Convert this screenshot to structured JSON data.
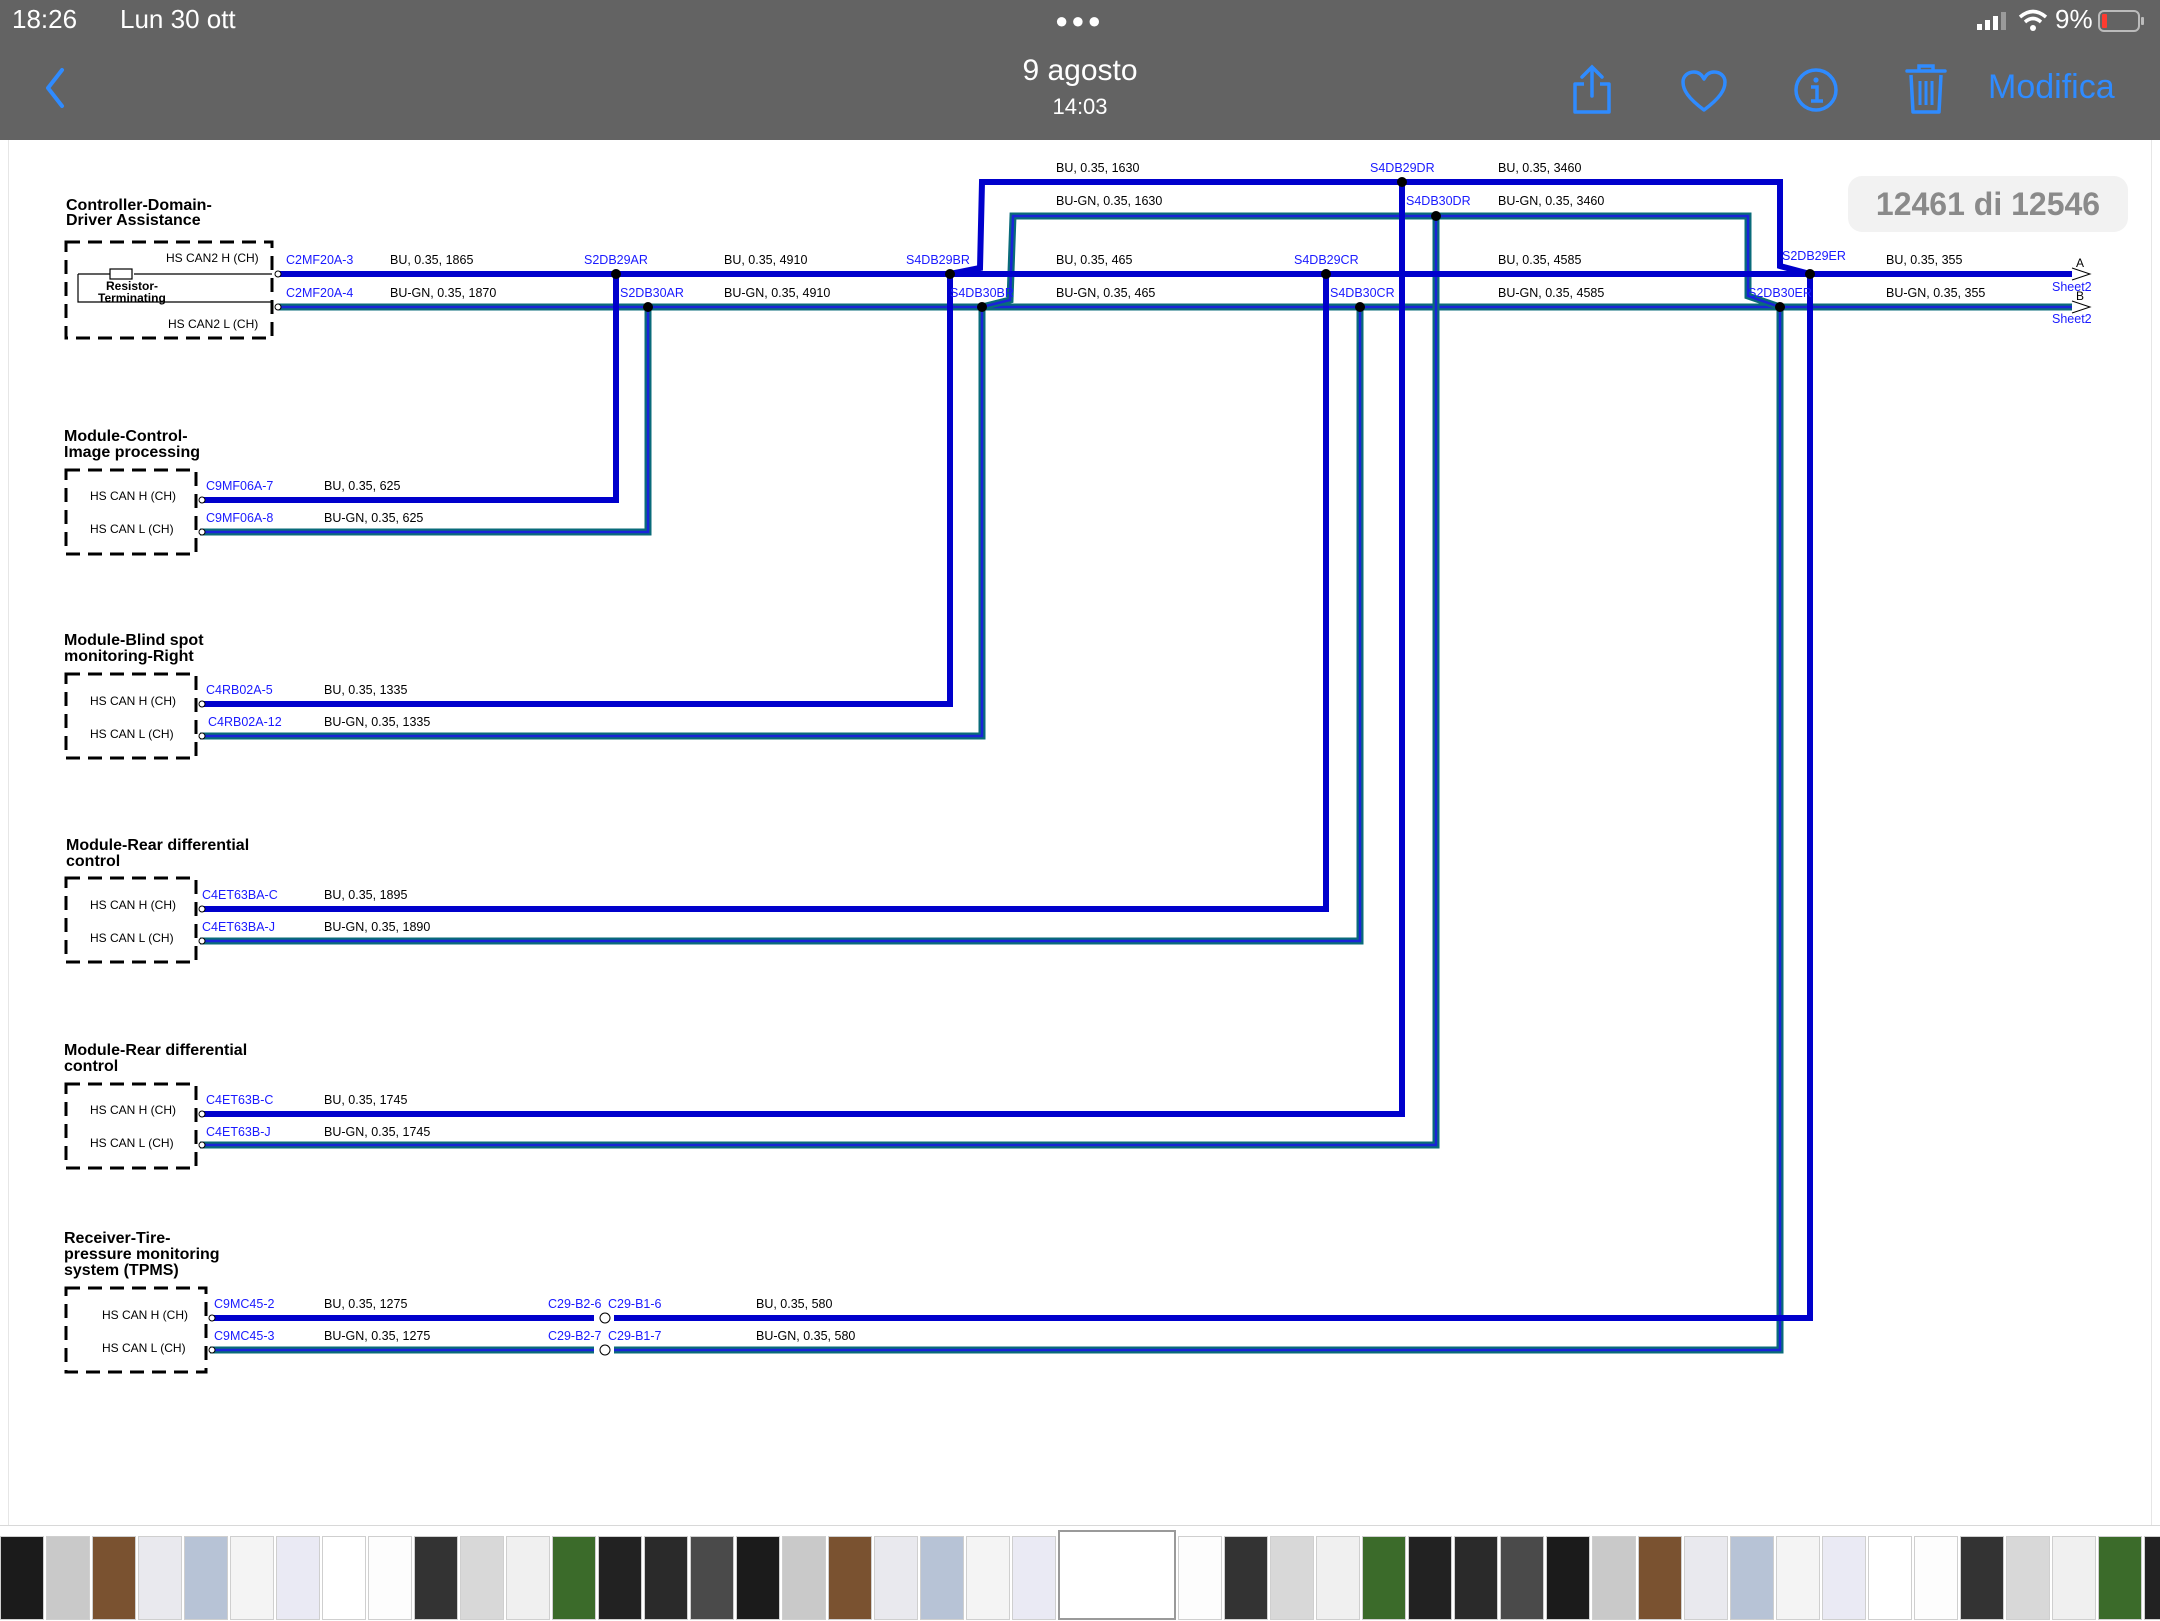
{
  "status": {
    "time": "18:26",
    "date": "Lun 30 ott",
    "battery": "9%"
  },
  "nav": {
    "title": "9 agosto",
    "subtitle": "14:03",
    "edit_label": "Modifica",
    "icons": [
      "back-chevron-icon",
      "share-icon",
      "heart-icon",
      "info-icon",
      "trash-icon"
    ]
  },
  "counter": "12461 di 12546",
  "colors": {
    "bu_wire": "#0000cc",
    "bu_gn_outer": "#0a6b7a",
    "bu_gn_inner": "#1a23d8",
    "label_blue": "#1a1aff",
    "accent": "#2f8bff"
  },
  "diagram": {
    "modules": [
      {
        "title1": "Controller-Domain-",
        "title2": "Driver Assistance",
        "h": "HS CAN2 H (CH)",
        "l": "HS CAN2 L (CH)",
        "resistor": "Resistor-",
        "resistor2": "Terminating"
      },
      {
        "title1": "Module-Control-",
        "title2": "Image processing",
        "h": "HS CAN H (CH)",
        "l": "HS CAN L (CH)"
      },
      {
        "title1": "Module-Blind spot",
        "title2": "monitoring-Right",
        "h": "HS CAN H (CH)",
        "l": "HS CAN L (CH)"
      },
      {
        "title1": "Module-Rear differential",
        "title2": "control",
        "h": "HS CAN H (CH)",
        "l": "HS CAN L (CH)"
      },
      {
        "title1": "Module-Rear differential",
        "title2": "control",
        "h": "HS CAN H (CH)",
        "l": "HS CAN L (CH)"
      },
      {
        "title1": "Receiver-Tire-",
        "title2": "pressure monitoring",
        "title3": "system (TPMS)",
        "h": "HS CAN H (CH)",
        "l": "HS CAN L (CH)"
      }
    ],
    "connectors": {
      "c2mf20a_3": "C2MF20A-3",
      "c2mf20a_4": "C2MF20A-4",
      "c9mf06a_7": "C9MF06A-7",
      "c9mf06a_8": "C9MF06A-8",
      "c4rb02a_5": "C4RB02A-5",
      "c4rb02a_12": "C4RB02A-12",
      "c4et63ba_c": "C4ET63BA-C",
      "c4et63ba_j": "C4ET63BA-J",
      "c4et63b_c": "C4ET63B-C",
      "c4et63b_j": "C4ET63B-J",
      "c9mc45_2": "C9MC45-2",
      "c9mc45_3": "C9MC45-3",
      "c29b2_6": "C29-B2-6",
      "c29b1_6": "C29-B1-6",
      "c29b2_7": "C29-B2-7",
      "c29b1_7": "C29-B1-7"
    },
    "splices": {
      "s2db29ar": "S2DB29AR",
      "s2db30ar": "S2DB30AR",
      "s4db29br": "S4DB29BR",
      "s4db30br": "S4DB30BR",
      "s4db29cr": "S4DB29CR",
      "s4db30cr": "S4DB30CR",
      "s4db29dr": "S4DB29DR",
      "s4db30dr": "S4DB30DR",
      "s2db29er": "S2DB29ER",
      "s2db30er": "S2DB30ER"
    },
    "wires": {
      "w1": "BU,  0.35,  1865",
      "w2": "BU-GN,  0.35,  1870",
      "w3": "BU,  0.35,  4910",
      "w4": "BU-GN,  0.35,  4910",
      "w5": "BU,  0.35,  465",
      "w6": "BU-GN,  0.35,  465",
      "w7": "BU,  0.35,  4585",
      "w8": "BU-GN,  0.35,  4585",
      "w9": "BU,  0.35,  355",
      "w10": "BU-GN,  0.35,  355",
      "w11": "BU,  0.35,  1630",
      "w12": "BU-GN,  0.35,  1630",
      "w13": "BU,  0.35,  3460",
      "w14": "BU-GN,  0.35,  3460",
      "w15": "BU,  0.35,  625",
      "w16": "BU-GN,  0.35,  625",
      "w17": "BU,  0.35,  1335",
      "w18": "BU-GN,  0.35,  1335",
      "w19": "BU,  0.35,  1895",
      "w20": "BU-GN,  0.35,  1890",
      "w21": "BU,  0.35,  1745",
      "w22": "BU-GN,  0.35,  1745",
      "w23": "BU,  0.35,  1275",
      "w24": "BU-GN,  0.35,  1275",
      "w25": "BU,  0.35,  580",
      "w26": "BU-GN,  0.35,  580"
    },
    "offpage": {
      "a": "A",
      "b": "B",
      "sheet_a": "Sheet2",
      "sheet_b": "Sheet2"
    }
  }
}
